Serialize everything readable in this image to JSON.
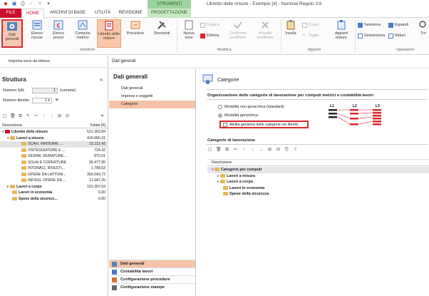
{
  "window": {
    "title": "Libretto delle misure - Esempio [4] - Namirial Regolo 3.6"
  },
  "tabs": {
    "file": "FILE",
    "home": "HOME",
    "archivi": "ARCHIVI DI BASE",
    "utilita": "UTILITÀ",
    "revisione": "REVISIONE",
    "strumenti_context": "STRUMENTI",
    "progettazione": "PROGETTAZIONE"
  },
  "ribbon": {
    "dati_generali": "Dati generali",
    "elenco_risorse": "Elenco risorse",
    "elenco_prezzi": "Elenco prezzi",
    "computo_metrico": "Computo metrico",
    "libretto_misure": "Libretto delle misure",
    "procedure": "Procedure",
    "strumenti": "Strumenti",
    "nuova_voce": "Nuova voce",
    "duplica": "Duplica",
    "elimina": "Elimina",
    "conferma_modifiche": "Conferma modifiche",
    "annulla_modifiche": "Annulla modifiche",
    "incolla": "Incolla",
    "copia": "Copia",
    "taglia": "Taglia",
    "appunti_misure": "Appunti misure",
    "seleziona": "Seleziona",
    "deseleziona": "Deseleziona",
    "espandi": "Espandi",
    "riduci": "Riduci",
    "tro": "Tro",
    "group_selettore": "Selettore",
    "group_modifica": "Modifica",
    "group_appunti": "Appunti",
    "group_operazioni": "Operazioni"
  },
  "left": {
    "import_label": "Importa voce da elenco",
    "struttura_title": "Struttura",
    "collapse_glyph": "«",
    "numero_sal_label": "Numero SAL",
    "numero_sal_value": "1",
    "numero_sal_note": "(corrente)",
    "numero_libretto_label": "Numero libretto",
    "numero_libretto_value": "1",
    "col_descrizione": "Descrizione",
    "col_totale": "Totale [€]",
    "tree": [
      {
        "label": "Libretto delle misure",
        "value": "521.363,84"
      },
      {
        "label": "Lavori a misura",
        "value": "419.966,31"
      },
      {
        "label": "SCAVI, RINTERRI, ...",
        "value": "15.112,43"
      },
      {
        "label": "TINTEGGIATURE E ...",
        "value": "724,42"
      },
      {
        "label": "VESPAI, MURATURE...",
        "value": "872,01"
      },
      {
        "label": "SOLAI E COPERTURE",
        "value": "39.477,95"
      },
      {
        "label": "INTONACI, RIVESTI...",
        "value": "1.788,53"
      },
      {
        "label": "OPERE DA LATTONI...",
        "value": "350.043,72"
      },
      {
        "label": "INFISSI, OPERE DA ...",
        "value": "11.947,25"
      },
      {
        "label": "Lavori a corpo",
        "value": "101.397,53"
      },
      {
        "label": "Lavori in economia",
        "value": "0,00"
      },
      {
        "label": "Spese della sicurezz...",
        "value": "0,00"
      }
    ]
  },
  "nav": {
    "header": "Dati generali",
    "title": "Dati generali",
    "items": [
      "Dati generali",
      "Imprese e soggetti",
      "Categorie"
    ],
    "bottom": [
      "Dati generali",
      "Contabilità lavori",
      "Configurazione procedure",
      "Configurazione stampe"
    ]
  },
  "content": {
    "title": "Categorie",
    "org_heading": "Organizzazione delle categorie di lavorazione per computi metrici e contabilità lavori",
    "radio_non_gerarchica": "Modalità non gerarchica (standard)",
    "radio_gerarchica": "Modalità gerarchica",
    "checkbox_label": "Abilita gestione delle categorie nei libretti",
    "levels": [
      "L1",
      "L2",
      "L3"
    ],
    "cat_lav_heading": "Categorie di lavorazione",
    "col_descrizione": "Descrizione",
    "cat_tree": [
      "Categorie per computi",
      "Lavori a misura",
      "Lavori a corpo",
      "Lavori in economia",
      "Spese della sicurezza"
    ]
  },
  "colors": {
    "accent_red": "#c8102e",
    "selected_orange": "#f4c3a8",
    "highlight_border": "#d9272e",
    "context_green": "#9ed39f"
  }
}
